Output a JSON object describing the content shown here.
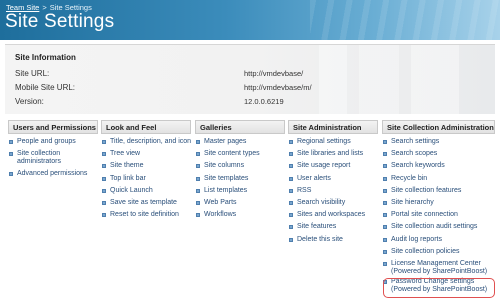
{
  "breadcrumb": {
    "site": "Team Site",
    "separator": ">",
    "current": "Site Settings"
  },
  "title": "Site Settings",
  "site_info": {
    "heading": "Site Information",
    "rows": [
      {
        "label": "Site URL:",
        "value": "http://vmdevbase/"
      },
      {
        "label": "Mobile Site URL:",
        "value": "http://vmdevbase/m/"
      },
      {
        "label": "Version:",
        "value": "12.0.0.6219"
      }
    ]
  },
  "columns": [
    {
      "header": "Users and Permissions",
      "items": [
        "People and groups",
        "Site collection administrators",
        "Advanced permissions"
      ]
    },
    {
      "header": "Look and Feel",
      "items": [
        "Title, description, and icon",
        "Tree view",
        "Site theme",
        "Top link bar",
        "Quick Launch",
        "Save site as template",
        "Reset to site definition"
      ]
    },
    {
      "header": "Galleries",
      "items": [
        "Master pages",
        "Site content types",
        "Site columns",
        "Site templates",
        "List templates",
        "Web Parts",
        "Workflows"
      ]
    },
    {
      "header": "Site Administration",
      "items": [
        "Regional settings",
        "Site libraries and lists",
        "Site usage report",
        "User alerts",
        "RSS",
        "Search visibility",
        "Sites and workspaces",
        "Site features",
        "Delete this site"
      ]
    },
    {
      "header": "Site Collection Administration",
      "items": [
        "Search settings",
        "Search scopes",
        "Search keywords",
        "Recycle bin",
        "Site collection features",
        "Site hierarchy",
        "Portal site connection",
        "Site collection audit settings",
        "Audit log reports",
        "Site collection policies",
        "License Management Center",
        "(Powered by SharePointBoost)",
        "Password Change settings",
        "(Powered by SharePointBoost)"
      ]
    }
  ],
  "colors": {
    "header_start": "#1e6e9c",
    "header_end": "#a8d2ea",
    "link": "#2a4f7a",
    "highlight": "#e05050"
  }
}
